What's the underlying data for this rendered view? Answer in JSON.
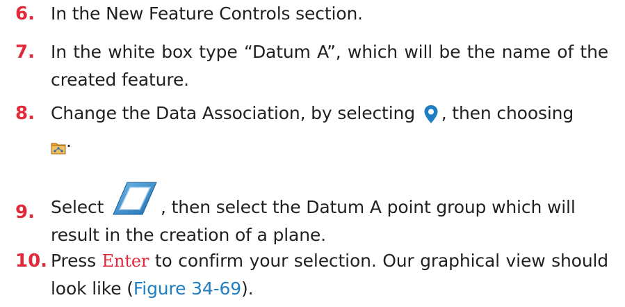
{
  "steps": [
    {
      "number": "6.",
      "text": "In the New Feature Controls section."
    },
    {
      "number": "7.",
      "text": "In the white box type “Datum A”, which will be the name of the created feature."
    },
    {
      "number": "8.",
      "text_before_icon": "Change the Data Association, by selecting",
      "text_after_icon": ", then choosing",
      "icon_1": "location-pin-icon",
      "icon_2": "folder-point-group-icon",
      "text_end": "."
    },
    {
      "number": "9.",
      "text_before_icon": "Select",
      "icon": "plane-icon",
      "text_after_icon": ", then select the Datum A point group which will result in the creation of a plane."
    },
    {
      "number": "10.",
      "text_before_key": "Press",
      "key": "Enter",
      "text_after_key": "to confirm your selection. Our graphical view should look like (",
      "figure_ref": "Figure 34-69",
      "text_end": ")."
    }
  ],
  "colors": {
    "step_number": "#e2293a",
    "body_text": "#231f20",
    "key_text": "#e2293a",
    "figure_link": "#1f7ec1",
    "pin_icon": "#1f7ec1"
  }
}
